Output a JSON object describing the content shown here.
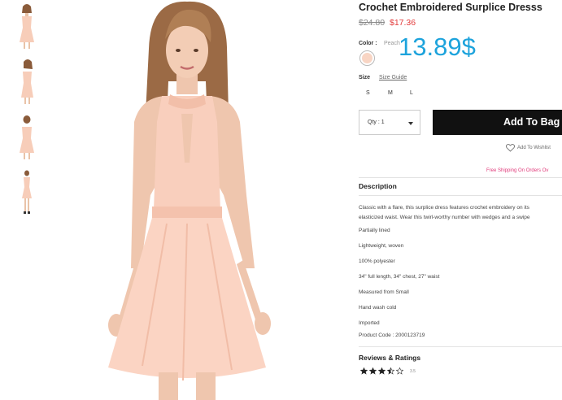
{
  "product": {
    "title": "Crochet Embroidered Surplice Dresss",
    "price_original": "$24.80",
    "price_sale": "$17.36",
    "overlay_price": "13.89$"
  },
  "color": {
    "label": "Color",
    "separator": ":",
    "value": "Peach",
    "swatch_color": "#f8d5c4"
  },
  "size": {
    "label": "Size",
    "guide_label": "Size Guide",
    "options": [
      "S",
      "M",
      "L"
    ]
  },
  "quantity": {
    "label": "Qty : 1"
  },
  "actions": {
    "add_to_bag": "Add To Bag",
    "wishlist": "Add To Wishlist",
    "shipping": "Free Shipping On Orders Ov"
  },
  "description": {
    "heading": "Description",
    "paragraph_lines": [
      "Classic with a flare, this surplice dress features crochet embroidery on its",
      "elasticized waist. Wear this twirl-worthy number with wedges and a swipe"
    ],
    "details": [
      "Partially lined",
      "Lightweight, woven",
      "100% polyester",
      "34\" full length, 34\" chest, 27\" waist",
      "Measured from Small",
      "Hand wash cold",
      "Imported",
      "Product Code : 2000123719"
    ]
  },
  "reviews": {
    "heading": "Reviews & Ratings",
    "rating": 3.5,
    "rating_text": "3.5",
    "max": 5
  },
  "colors": {
    "overlay": "#1da3dc",
    "sale": "#e23b3b",
    "shipping": "#e03a7a",
    "button": "#111111"
  }
}
